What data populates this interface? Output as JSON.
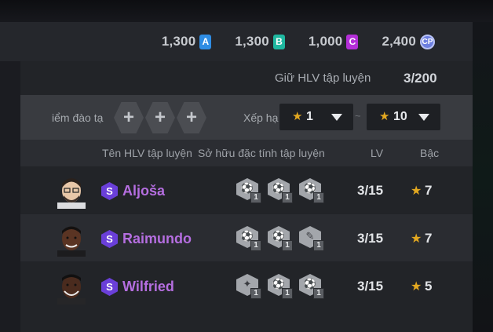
{
  "currencies": [
    {
      "amount": "1,300",
      "letter": "A",
      "color": "#2f8de4"
    },
    {
      "amount": "1,300",
      "letter": "B",
      "color": "#1fb8a0"
    },
    {
      "amount": "1,000",
      "letter": "C",
      "color": "#b42fd8"
    },
    {
      "amount": "2,400",
      "letter": "CP",
      "color": "#6d7fe0"
    }
  ],
  "hold": {
    "label": "Giữ HLV tập luyện",
    "value": "3/200"
  },
  "filter": {
    "points_label": "iểm đào tạ",
    "add_symbol": "+",
    "rank_label": "Xếp hạ",
    "range_sep": "~",
    "min_rank": "1",
    "max_rank": "10"
  },
  "columns": {
    "name": "Tên HLV tập luyện",
    "traits": "Sở hữu đặc tính tập luyện",
    "lv": "LV",
    "grade": "Bậc"
  },
  "rarity_badge": "S",
  "rows": [
    {
      "name": "Aljoša",
      "lv": "3/15",
      "grade": "7",
      "traits": [
        {
          "icon": "boot-trait-icon",
          "glyph": "⚽",
          "level": "1"
        },
        {
          "icon": "boot-trait-icon",
          "glyph": "⚽",
          "level": "1"
        },
        {
          "icon": "ball-trait-icon",
          "glyph": "⚽",
          "level": "1"
        }
      ],
      "skin": "#e8c7a8",
      "hair": "#2a211c"
    },
    {
      "name": "Raimundo",
      "lv": "3/15",
      "grade": "7",
      "traits": [
        {
          "icon": "boot-trait-icon",
          "glyph": "⚽",
          "level": "1"
        },
        {
          "icon": "ball-trait-icon",
          "glyph": "⚽",
          "level": "1"
        },
        {
          "icon": "whistle-trait-icon",
          "glyph": "✎",
          "level": "1"
        }
      ],
      "skin": "#5a3423",
      "hair": "#141110"
    },
    {
      "name": "Wilfried",
      "lv": "3/15",
      "grade": "5",
      "traits": [
        {
          "icon": "player-trait-icon",
          "glyph": "✦",
          "level": "1"
        },
        {
          "icon": "ball-trait-icon",
          "glyph": "⚽",
          "level": "1"
        },
        {
          "icon": "ball-trait-icon",
          "glyph": "⚽",
          "level": "1"
        }
      ],
      "skin": "#4a2b1e",
      "hair": "#111010"
    }
  ],
  "star_glyph": "★"
}
